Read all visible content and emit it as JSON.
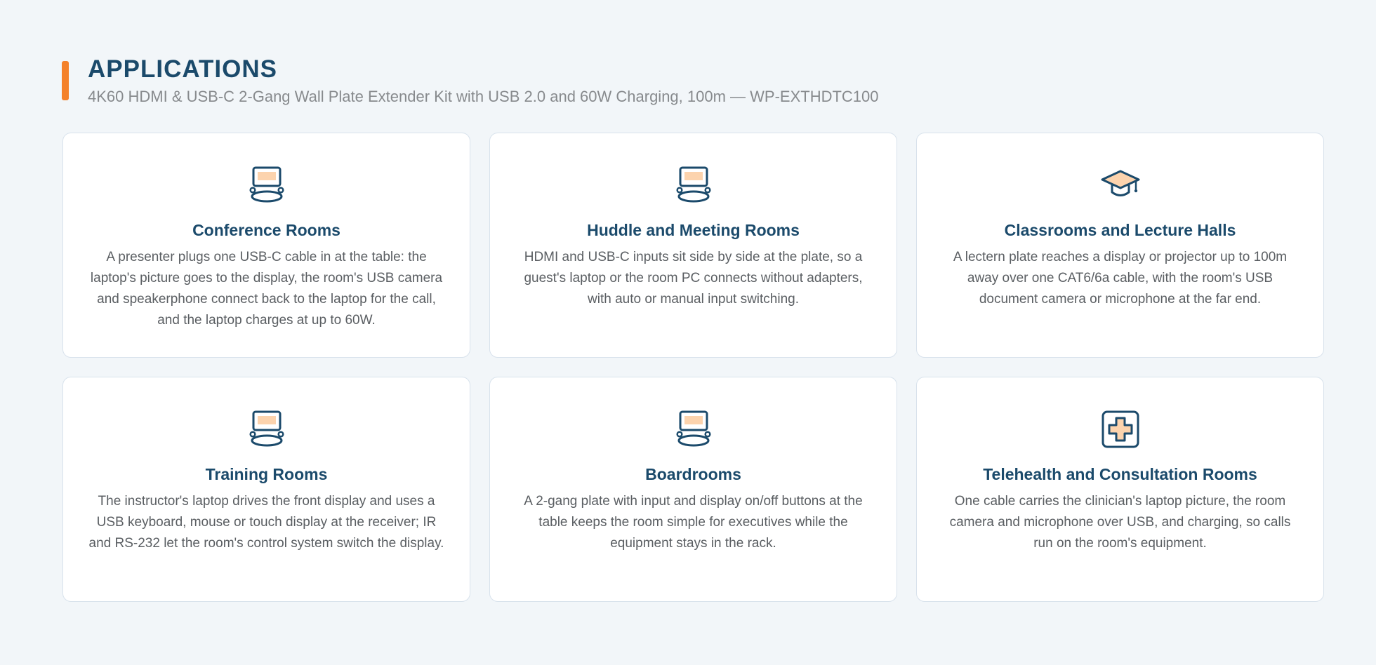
{
  "header": {
    "title": "APPLICATIONS",
    "subtitle": "4K60 HDMI & USB-C 2-Gang Wall Plate Extender Kit with USB 2.0 and 60W Charging, 100m — WP-EXTHDTC100"
  },
  "colors": {
    "accent": "#f4812a",
    "primary": "#1b4a6b",
    "icon_fill": "#fcd3ad",
    "background": "#f2f6f9",
    "card_border": "#d8e2ec"
  },
  "cards": [
    {
      "icon": "conference-table-icon",
      "title": "Conference Rooms",
      "description": "A presenter plugs one USB-C cable in at the table: the laptop's picture goes to the display, the room's USB camera and speakerphone connect back to the laptop for the call, and the laptop charges at up to 60W."
    },
    {
      "icon": "conference-table-icon",
      "title": "Huddle and Meeting Rooms",
      "description": "HDMI and USB-C inputs sit side by side at the plate, so a guest's laptop or the room PC connects without adapters, with auto or manual input switching."
    },
    {
      "icon": "graduation-cap-icon",
      "title": "Classrooms and Lecture Halls",
      "description": "A lectern plate reaches a display or projector up to 100m away over one CAT6/6a cable, with the room's USB document camera or microphone at the far end."
    },
    {
      "icon": "conference-table-icon",
      "title": "Training Rooms",
      "description": "The instructor's laptop drives the front display and uses a USB keyboard, mouse or touch display at the receiver; IR and RS-232 let the room's control system switch the display."
    },
    {
      "icon": "conference-table-icon",
      "title": "Boardrooms",
      "description": "A 2-gang plate with input and display on/off buttons at the table keeps the room simple for executives while the equipment stays in the rack."
    },
    {
      "icon": "medical-cross-icon",
      "title": "Telehealth and Consultation Rooms",
      "description": "One cable carries the clinician's laptop picture, the room camera and microphone over USB, and charging, so calls run on the room's equipment."
    }
  ]
}
